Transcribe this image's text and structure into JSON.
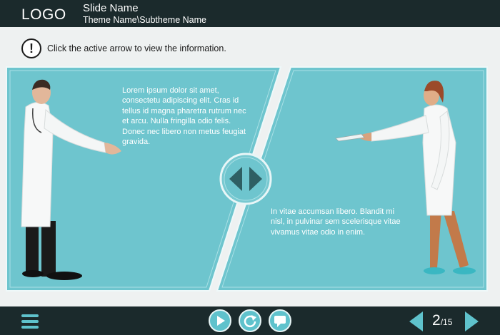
{
  "header": {
    "logo": "LOGO",
    "slide_name": "Slide Name",
    "theme_name": "Theme Name\\Subtheme Name"
  },
  "instruction": {
    "icon": "exclamation-icon",
    "text": "Click the active arrow to view the information."
  },
  "panels": {
    "left_text": "Lorem ipsum dolor sit amet, consectetu adipiscing elit. Cras id tellus id magna pharetra rutrum nec et arcu. Nulla fringilla odio felis. Donec nec libero non metus feugiat gravida.",
    "right_text": "In vitae accumsan libero. Blandit mi nisl, in pulvinar sem scelerisque vitae vivamus vitae odio in enim.",
    "left_image": "male-doctor-extending-hand",
    "right_image": "female-doctor-handing-papers",
    "swap_control": "left-right-arrows-icon"
  },
  "footer": {
    "menu_icon": "hamburger-menu-icon",
    "play_icon": "play-icon",
    "replay_icon": "replay-icon",
    "comment_icon": "speech-bubble-icon",
    "current_page": "2",
    "total_pages": "/15"
  },
  "colors": {
    "bar": "#1b2a2c",
    "panel": "#6ec5ce",
    "accent": "#5fc2cc"
  }
}
